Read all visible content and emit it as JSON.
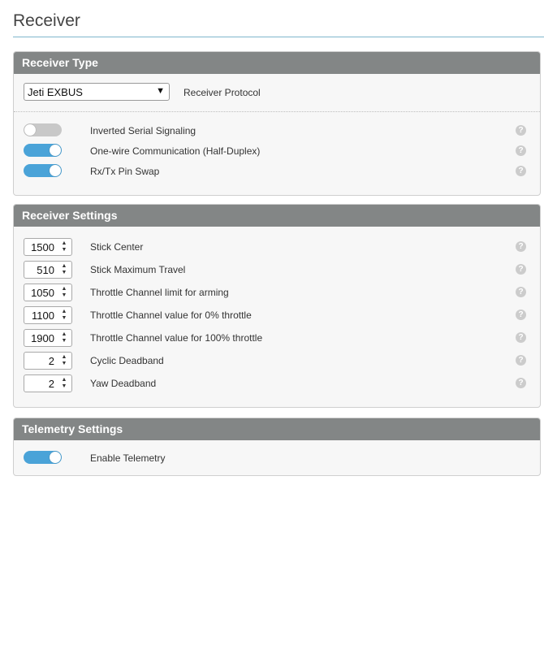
{
  "page": {
    "title": "Receiver"
  },
  "receiver_type": {
    "header": "Receiver Type",
    "protocol_select": {
      "value": "Jeti EXBUS",
      "label": "Receiver Protocol"
    },
    "toggles": [
      {
        "label": "Inverted Serial Signaling",
        "on": false
      },
      {
        "label": "One-wire Communication (Half-Duplex)",
        "on": true
      },
      {
        "label": "Rx/Tx Pin Swap",
        "on": true
      }
    ]
  },
  "receiver_settings": {
    "header": "Receiver Settings",
    "fields": [
      {
        "value": "1500",
        "label": "Stick Center"
      },
      {
        "value": "510",
        "label": "Stick Maximum Travel"
      },
      {
        "value": "1050",
        "label": "Throttle Channel limit for arming"
      },
      {
        "value": "1100",
        "label": "Throttle Channel value for 0% throttle"
      },
      {
        "value": "1900",
        "label": "Throttle Channel value for 100% throttle"
      },
      {
        "value": "2",
        "label": "Cyclic Deadband"
      },
      {
        "value": "2",
        "label": "Yaw Deadband"
      }
    ]
  },
  "telemetry_settings": {
    "header": "Telemetry Settings",
    "toggles": [
      {
        "label": "Enable Telemetry",
        "on": true
      }
    ]
  },
  "help_icon_glyph": "?",
  "colors": {
    "accent": "#4aa3d8",
    "header_bg": "#838686"
  }
}
